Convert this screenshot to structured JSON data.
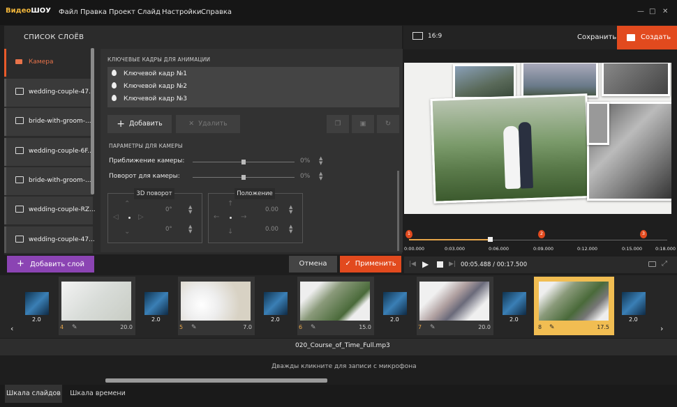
{
  "titlebar": {
    "logo_a": "Видео",
    "logo_b": "ШОУ",
    "menu": [
      "Файл",
      "Правка",
      "Проект",
      "Слайд",
      "Настройки",
      "Справка"
    ]
  },
  "layers": {
    "title": "СПИСОК СЛОЁВ",
    "items": [
      {
        "label": "Камера",
        "active": true
      },
      {
        "label": "wedding-couple-47..."
      },
      {
        "label": "bride-with-groom-..."
      },
      {
        "label": "wedding-couple-6F..."
      },
      {
        "label": "bride-with-groom-..."
      },
      {
        "label": "wedding-couple-RZ..."
      },
      {
        "label": "wedding-couple-47..."
      }
    ],
    "add_label": "Добавить слой"
  },
  "keyframes": {
    "section": "КЛЮЧЕВЫЕ КАДРЫ ДЛЯ АНИМАЦИИ",
    "items": [
      "Ключевой кадр №1",
      "Ключевой кадр №2",
      "Ключевой кадр №3"
    ],
    "add_label": "Добавить",
    "delete_label": "Удалить"
  },
  "camera": {
    "section": "ПАРАМЕТРЫ ДЛЯ КАМЕРЫ",
    "zoom_label": "Приближение камеры:",
    "zoom_value": "0%",
    "rotate_label": "Поворот для камеры:",
    "rotate_value": "0%",
    "rotate3d_title": "3D поворот",
    "rotate3d_a": "0°",
    "rotate3d_b": "0°",
    "position_title": "Положение",
    "position_x": "0.00",
    "position_y": "0.00"
  },
  "footer": {
    "cancel": "Отмена",
    "apply": "Применить"
  },
  "preview": {
    "aspect": "16:9",
    "save": "Сохранить",
    "create": "Создать"
  },
  "timeline": {
    "ticks": [
      "0:00.000",
      "0:03.000",
      "0:06.000",
      "0:09.000",
      "0:12.000",
      "0:15.000",
      "0:18.000"
    ],
    "markers": [
      "1",
      "2",
      "3"
    ],
    "time": "00:05.488 / 00:17.500",
    "playhead_fraction": 0.313
  },
  "strip": {
    "transitions": [
      "2.0",
      "2.0",
      "2.0",
      "2.0",
      "2.0",
      "2.0"
    ],
    "slides": [
      {
        "num": "4",
        "dur": "20.0"
      },
      {
        "num": "5",
        "dur": "7.0"
      },
      {
        "num": "6",
        "dur": "15.0"
      },
      {
        "num": "7",
        "dur": "20.0"
      },
      {
        "num": "8",
        "dur": "17.5",
        "selected": true
      }
    ]
  },
  "audio": {
    "file": "020_Course_of_Time_Full.mp3",
    "mic_hint": "Дважды кликните для записи с микрофона"
  },
  "tabs": {
    "slides": "Шкала слайдов",
    "timeline": "Шкала времени"
  },
  "colors": {
    "accent": "#e24a1e",
    "purple": "#8b44b3",
    "selected_slide": "#f1bd52",
    "logo": "#f0b53a"
  }
}
